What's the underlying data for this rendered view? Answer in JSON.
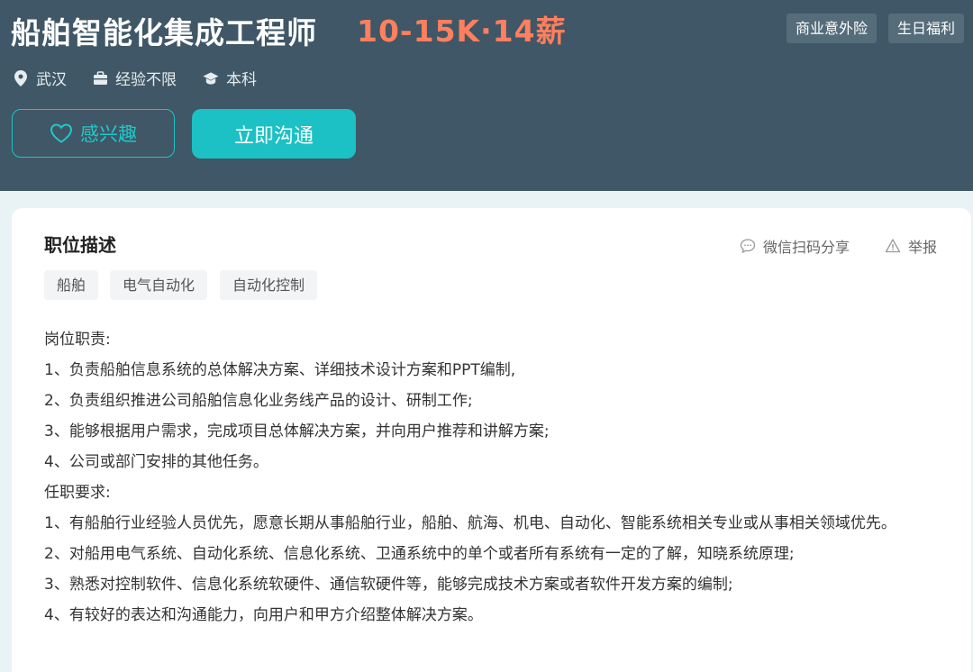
{
  "header": {
    "title": "船舶智能化集成工程师",
    "salary": "10-15K·14薪",
    "benefits": [
      "商业意外险",
      "生日福利"
    ],
    "meta": [
      {
        "icon": "location-pin-icon",
        "text": "武汉"
      },
      {
        "icon": "briefcase-icon",
        "text": "经验不限"
      },
      {
        "icon": "graduation-cap-icon",
        "text": "本科"
      }
    ],
    "interest_label": "感兴趣",
    "chat_label": "立即沟通"
  },
  "colors": {
    "header_bg": "#3f5766",
    "salary": "#ff7f5e",
    "accent": "#1bc1c4"
  },
  "description": {
    "title": "职位描述",
    "share_label": "微信扫码分享",
    "report_label": "举报",
    "tags": [
      "船舶",
      "电气自动化",
      "自动化控制"
    ],
    "lines": [
      "岗位职责:",
      "1、负责船舶信息系统的总体解决方案、详细技术设计方案和PPT编制,",
      "2、负责组织推进公司船舶信息化业务线产品的设计、研制工作;",
      "3、能够根据用户需求，完成项目总体解决方案，并向用户推荐和讲解方案;",
      "4、公司或部门安排的其他任务。",
      "任职要求:",
      "1、有船舶行业经验人员优先，愿意长期从事船舶行业，船舶、航海、机电、自动化、智能系统相关专业或从事相关领域优先。",
      "2、对船用电气系统、自动化系统、信息化系统、卫通系统中的单个或者所有系统有一定的了解，知晓系统原理;",
      "3、熟悉对控制软件、信息化系统软硬件、通信软硬件等，能够完成技术方案或者软件开发方案的编制;",
      "4、有较好的表达和沟通能力，向用户和甲方介绍整体解决方案。"
    ]
  }
}
